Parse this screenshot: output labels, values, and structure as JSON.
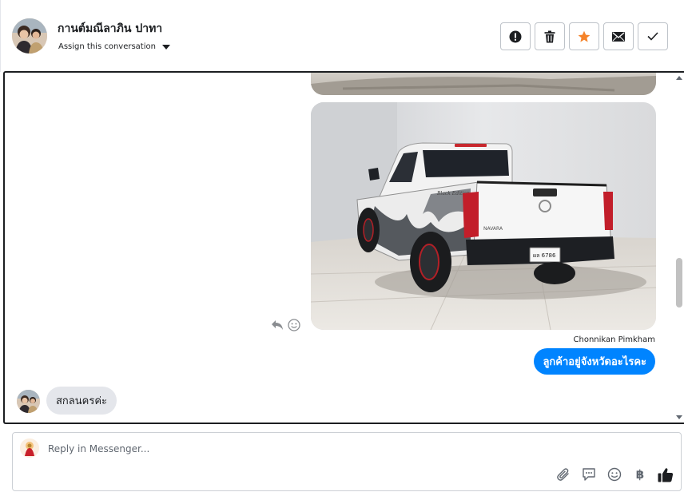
{
  "header": {
    "contact_name": "กานต์มณีลาภิน ปาทา",
    "assign_label": "Assign this conversation",
    "actions": [
      {
        "icon": "alert-icon",
        "color": "#1c1e21"
      },
      {
        "icon": "trash-icon",
        "color": "#1c1e21"
      },
      {
        "icon": "star-icon",
        "color": "#f5832a"
      },
      {
        "icon": "envelope-icon",
        "color": "#1c1e21"
      },
      {
        "icon": "check-icon",
        "color": "#1c1e21"
      }
    ]
  },
  "conversation": {
    "sender_name": "Chonnikan Pimkham",
    "outgoing_message": "ลูกค้าอยู่จังหวัดอะไรคะ",
    "incoming_message": "สกลนครค่ะ",
    "car_plate": "ผล 6786",
    "car_brand_text": "NAVARA",
    "car_decal_text": "Black Edition"
  },
  "reply": {
    "placeholder": "Reply in Messenger...",
    "tools": [
      "paperclip-icon",
      "saved-reply-icon",
      "emoji-icon",
      "baht-icon",
      "thumbs-up-icon"
    ],
    "baht_symbol": "฿"
  },
  "colors": {
    "accent": "#0084ff",
    "incoming_bubble": "#e4e6eb",
    "star": "#f5832a"
  }
}
